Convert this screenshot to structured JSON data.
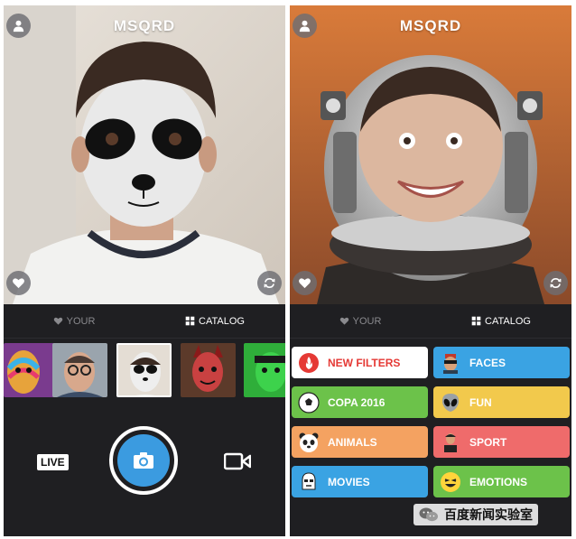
{
  "left_screen": {
    "app_title": "MSQRD",
    "tabs": [
      {
        "label": "YOUR",
        "icon": "heart-icon",
        "active": false
      },
      {
        "label": "CATALOG",
        "icon": "grid-icon",
        "active": true
      }
    ],
    "filters": [
      {
        "name": "rainbow-face-filter"
      },
      {
        "name": "glasses-man-filter"
      },
      {
        "name": "panda-filter",
        "selected": true
      },
      {
        "name": "demon-face-filter"
      },
      {
        "name": "green-man-filter"
      }
    ],
    "live_label": "LIVE",
    "shutter_icon": "camera-icon",
    "video_icon": "video-camera-icon"
  },
  "right_screen": {
    "app_title": "MSQRD",
    "tabs": [
      {
        "label": "YOUR",
        "icon": "heart-icon",
        "active": false
      },
      {
        "label": "CATALOG",
        "icon": "grid-icon",
        "active": true
      }
    ],
    "categories": [
      {
        "label": "NEW FILTERS",
        "color": "#ffffff",
        "text_color": "#e53935",
        "icon": "fire-icon"
      },
      {
        "label": "FACES",
        "color": "#3aa3e3",
        "text_color": "#ffffff",
        "icon": "mask-icon"
      },
      {
        "label": "COPA 2016",
        "color": "#6cc24a",
        "text_color": "#ffffff",
        "icon": "soccer-ball-icon"
      },
      {
        "label": "FUN",
        "color": "#f2c94c",
        "text_color": "#ffffff",
        "icon": "alien-icon"
      },
      {
        "label": "ANIMALS",
        "color": "#f4a261",
        "text_color": "#ffffff",
        "icon": "panda-icon"
      },
      {
        "label": "SPORT",
        "color": "#ef6b6b",
        "text_color": "#ffffff",
        "icon": "athlete-icon"
      },
      {
        "label": "MOVIES",
        "color": "#3aa3e3",
        "text_color": "#ffffff",
        "icon": "stormtrooper-icon"
      },
      {
        "label": "EMOTIONS",
        "color": "#6cc24a",
        "text_color": "#ffffff",
        "icon": "laughing-emoji-icon"
      }
    ]
  },
  "watermark": {
    "text": "百度新闻实验室",
    "icon": "wechat-icon"
  }
}
